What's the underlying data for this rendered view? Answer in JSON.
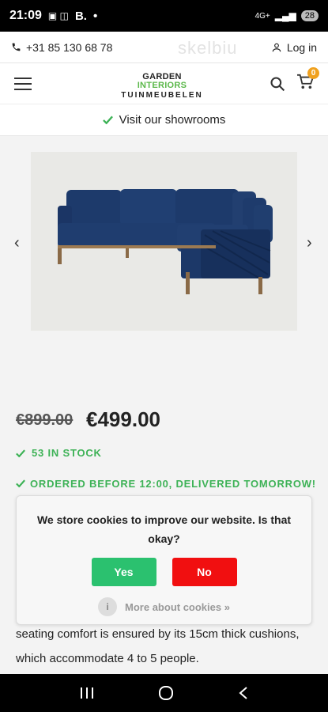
{
  "status": {
    "time": "21:09",
    "indicators": "B.",
    "network": "4G+",
    "battery": "28"
  },
  "topbar": {
    "phone": "+31 85 130 68 78",
    "login": "Log in",
    "watermark": "skelbiu"
  },
  "header": {
    "logo_line1_a": "GARDEN",
    "logo_line1_b": "INTERIORS",
    "logo_line2": "TUINMEUBELEN",
    "cart_count": "0"
  },
  "showrooms": {
    "label": "Visit our showrooms"
  },
  "product": {
    "price_old": "€899.00",
    "price_new": "€499.00",
    "stock": "53 IN STOCK",
    "delivery": "ORDERED BEFORE 12:00, DELIVERED TOMORROW!"
  },
  "cookie": {
    "message": "We store cookies to improve our website. Is that okay?",
    "yes": "Yes",
    "no": "No",
    "more": "More about cookies »",
    "colors": {
      "yes": "#2bc16f",
      "no": "#f10f10"
    }
  },
  "description": "seating comfort is ensured by its 15cm thick cushions, which accommodate 4 to 5 people.",
  "icons": [
    "phone-icon",
    "user-icon",
    "menu-icon",
    "search-icon",
    "cart-icon",
    "check-icon",
    "chevron-left-icon",
    "chevron-right-icon",
    "info-icon",
    "recent-apps-icon",
    "home-icon",
    "back-icon"
  ]
}
